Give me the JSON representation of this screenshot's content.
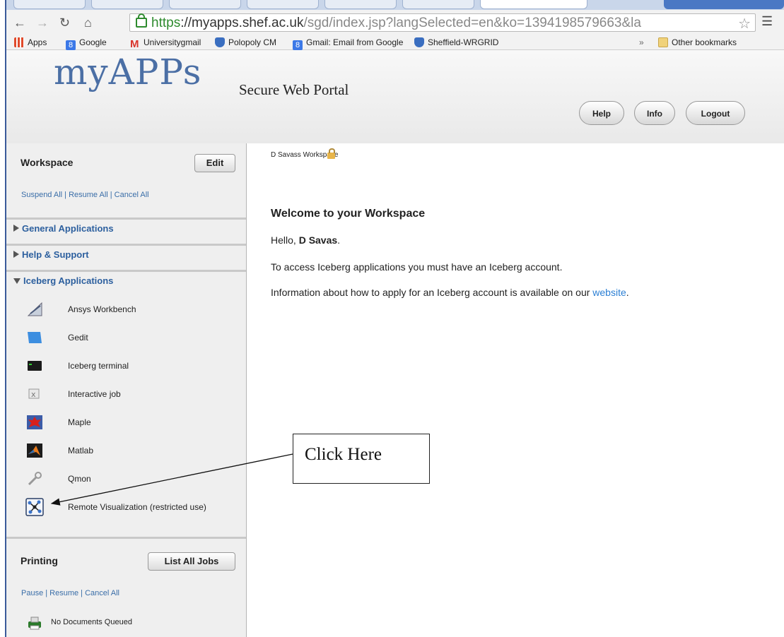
{
  "browser": {
    "url_scheme": "https",
    "url_host": "://myapps.shef.ac.uk",
    "url_path": "/sgd/index.jsp?langSelected=en&ko=1394198579663&la",
    "bookmarks": [
      {
        "label": "Apps",
        "icon": "apps-grid-icon",
        "color": "#e04a2b"
      },
      {
        "label": "Google",
        "icon": "google-icon",
        "color": "#3b78e7"
      },
      {
        "label": "Universitygmail",
        "icon": "gmail-icon",
        "color": "#d9342b"
      },
      {
        "label": "Polopoly CM",
        "icon": "shield-icon",
        "color": "#3a6ec0"
      },
      {
        "label": "Gmail: Email from Google",
        "icon": "google-icon",
        "color": "#3b78e7"
      },
      {
        "label": "Sheffield-WRGRID",
        "icon": "shield-icon",
        "color": "#3a6ec0"
      }
    ],
    "overflow": "»",
    "other_bookmarks": "Other bookmarks"
  },
  "header": {
    "logo": "myAPPs",
    "subtitle": "Secure Web Portal",
    "buttons": {
      "help": "Help",
      "info": "Info",
      "logout": "Logout"
    }
  },
  "sidebar": {
    "workspace_title": "Workspace",
    "edit_label": "Edit",
    "workspace_links": "Suspend All | Resume All | Cancel All",
    "sections": {
      "general": "General Applications",
      "help": "Help & Support",
      "iceberg": "Iceberg Applications"
    },
    "apps": [
      "Ansys Workbench",
      "Gedit",
      "Iceberg terminal",
      "Interactive job",
      "Maple",
      "Matlab",
      "Qmon",
      "Remote Visualization (restricted use)"
    ],
    "printing_title": "Printing",
    "list_jobs_label": "List All Jobs",
    "printing_links": "Pause | Resume | Cancel All",
    "no_docs": "No Documents Queued"
  },
  "main": {
    "workspace_label": "D Savass Workspace",
    "welcome": "Welcome to your Workspace",
    "hello_prefix": "Hello, ",
    "hello_name": "D Savas",
    "hello_suffix": ".",
    "access_text": "To access Iceberg applications you must have an Iceberg account.",
    "info_text": "Information about how to apply for an Iceberg account is available on our ",
    "website_link": "website",
    "info_suffix": "."
  },
  "annotation": {
    "callout": "Click Here"
  }
}
